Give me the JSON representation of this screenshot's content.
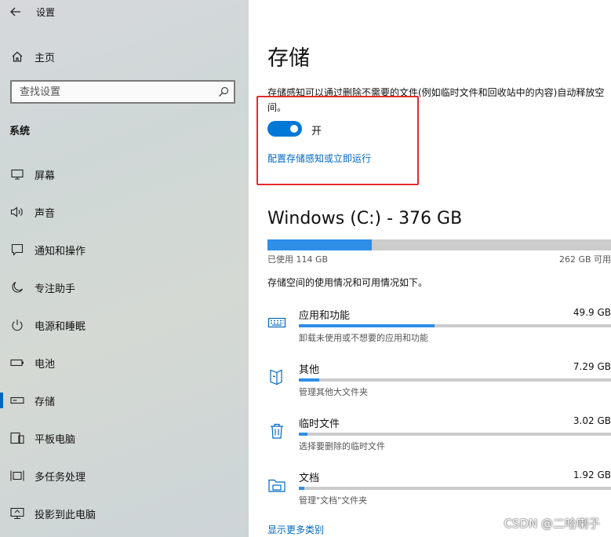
{
  "app": {
    "title": "设置"
  },
  "sidebar": {
    "home_label": "主页",
    "search_placeholder": "查找设置",
    "section_title": "系统",
    "items": [
      {
        "label": "屏幕",
        "icon": "monitor-icon"
      },
      {
        "label": "声音",
        "icon": "speaker-icon"
      },
      {
        "label": "通知和操作",
        "icon": "notification-icon"
      },
      {
        "label": "专注助手",
        "icon": "moon-icon"
      },
      {
        "label": "电源和睡眠",
        "icon": "power-icon"
      },
      {
        "label": "电池",
        "icon": "battery-icon"
      },
      {
        "label": "存储",
        "icon": "storage-icon",
        "active": true
      },
      {
        "label": "平板电脑",
        "icon": "tablet-icon"
      },
      {
        "label": "多任务处理",
        "icon": "multitask-icon"
      },
      {
        "label": "投影到此电脑",
        "icon": "project-icon"
      }
    ]
  },
  "main": {
    "title": "存储",
    "description": "存储感知可以通过删除不需要的文件(例如临时文件和回收站中的内容)自动释放空间。",
    "toggle": {
      "state_label": "开",
      "on": true
    },
    "config_link": "配置存储感知或立即运行",
    "drive": {
      "title": "Windows (C:) - 376 GB",
      "used_label": "已使用 114 GB",
      "free_label": "262 GB 可用",
      "used_fraction": 0.303
    },
    "usage_desc": "存储空间的使用情况和可用情况如下。",
    "categories": [
      {
        "name": "应用和功能",
        "size": "49.9 GB",
        "sub": "卸载未使用或不想要的应用和功能",
        "fraction": 0.435,
        "icon": "keyboard-icon"
      },
      {
        "name": "其他",
        "size": "7.29 GB",
        "sub": "管理其他大文件夹",
        "fraction": 0.065,
        "icon": "other-files-icon"
      },
      {
        "name": "临时文件",
        "size": "3.02 GB",
        "sub": "选择要删除的临时文件",
        "fraction": 0.027,
        "icon": "trash-icon"
      },
      {
        "name": "文档",
        "size": "1.92 GB",
        "sub": "管理\"文档\"文件夹",
        "fraction": 0.017,
        "icon": "folder-icon"
      }
    ],
    "more_link": "显示更多类别"
  },
  "watermark": "CSDN @二哈喇子"
}
